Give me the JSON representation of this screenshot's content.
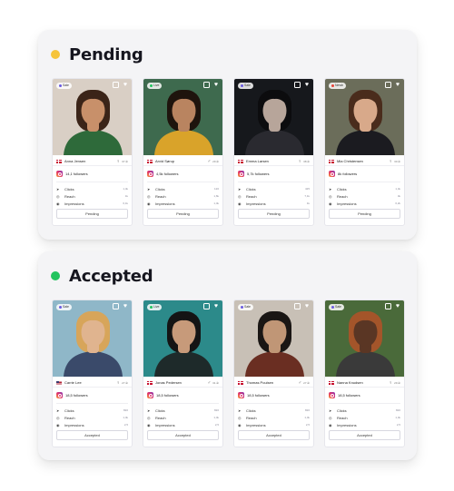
{
  "colors": {
    "pending_dot": "#f6c43b",
    "accepted_dot": "#22c45e"
  },
  "sections": [
    {
      "title": "Pending",
      "status_button": "Pending",
      "cards": [
        {
          "badge": "Sale",
          "name": "Anna Jensen",
          "flag": "dk",
          "gender": "♀",
          "age": "37 år",
          "followers": "14,1 followers",
          "clicks": "1,4k",
          "reach": "1k",
          "impressions": "6,1k",
          "photo": {
            "bg": "#d9cfc5",
            "hair": "#3b2418",
            "skin": "#c8906a",
            "cloth": "#2e6a3a"
          }
        },
        {
          "badge": "Live",
          "name": "Arvid Sørup",
          "flag": "dk",
          "gender": "♂",
          "age": "29 år",
          "followers": "4,5k followers",
          "clicks": "120",
          "reach": "1,6k",
          "impressions": "1,4k",
          "photo": {
            "bg": "#3e6a4e",
            "hair": "#1e140d",
            "skin": "#b98460",
            "cloth": "#d9a32a"
          }
        },
        {
          "badge": "Sale",
          "name": "Emma Larsen",
          "flag": "dk",
          "gender": "♀",
          "age": "38 år",
          "followers": "5,7k followers",
          "clicks": "425",
          "reach": "7,1k",
          "impressions": "1k",
          "photo": {
            "bg": "#16181c",
            "hair": "#0c0c0e",
            "skin": "#b7a59a",
            "cloth": "#2a2a30"
          }
        },
        {
          "badge": "Newb",
          "name": "Mia Christensen",
          "flag": "dk",
          "gender": "♀",
          "age": "30 år",
          "followers": "8k followers",
          "clicks": "1,4k",
          "reach": "4k",
          "impressions": "6,2k",
          "photo": {
            "bg": "#6b6d5a",
            "hair": "#4a2c1c",
            "skin": "#d8a98a",
            "cloth": "#1b1b20"
          }
        }
      ]
    },
    {
      "title": "Accepted",
      "status_button": "Accepted",
      "cards": [
        {
          "badge": "Sale",
          "name": "Carrie Lee",
          "flag": "us",
          "gender": "♀",
          "age": "27 år",
          "followers": "18,5 followers",
          "clicks": "820",
          "reach": "1,4k",
          "impressions": "2,5",
          "photo": {
            "bg": "#8fb7c8",
            "hair": "#d7a55a",
            "skin": "#e0b48f",
            "cloth": "#3a4a6a"
          }
        },
        {
          "badge": "Live",
          "name": "Jonas Pedersen",
          "flag": "dk",
          "gender": "♂",
          "age": "31 år",
          "followers": "18,5 followers",
          "clicks": "820",
          "reach": "1,4k",
          "impressions": "2,5",
          "photo": {
            "bg": "#2c8a8a",
            "hair": "#141414",
            "skin": "#c79a7a",
            "cloth": "#1e2a2a"
          }
        },
        {
          "badge": "Sale",
          "name": "Thomas Poulsen",
          "flag": "dk",
          "gender": "♂",
          "age": "27 år",
          "followers": "18,5 followers",
          "clicks": "820",
          "reach": "1,4k",
          "impressions": "2,5",
          "photo": {
            "bg": "#c8c0b6",
            "hair": "#1a1614",
            "skin": "#c09676",
            "cloth": "#6a2e22"
          }
        },
        {
          "badge": "Sale",
          "name": "Nanna Knudsen",
          "flag": "dk",
          "gender": "♀",
          "age": "29 år",
          "followers": "18,5 followers",
          "clicks": "820",
          "reach": "1,4k",
          "impressions": "2,5",
          "photo": {
            "bg": "#4a6a3a",
            "hair": "#a4552a",
            "skin": "#5a3624",
            "cloth": "#3a3a3a"
          }
        }
      ]
    }
  ],
  "stat_labels": {
    "clicks": "Clicks",
    "reach": "Reach",
    "impressions": "Impressions"
  },
  "icons": {
    "clicks": "cursor-icon",
    "reach": "target-icon",
    "impressions": "eye-icon"
  }
}
